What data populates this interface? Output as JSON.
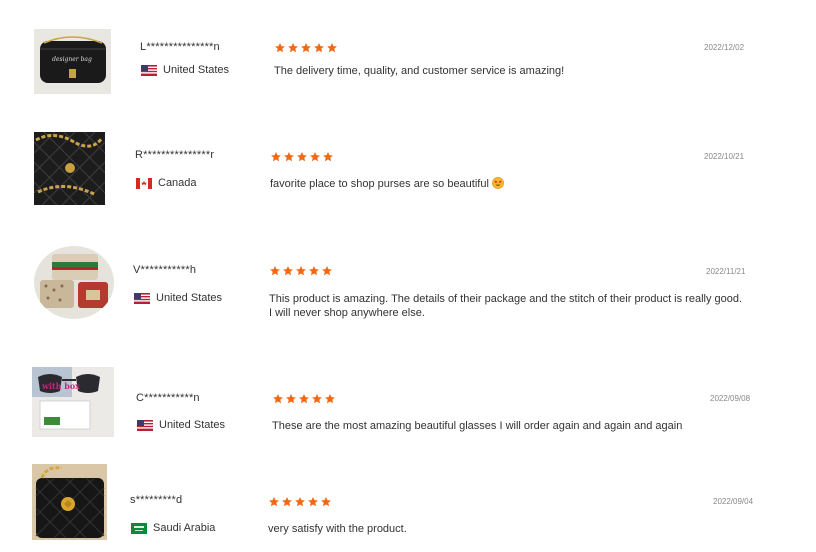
{
  "reviews": [
    {
      "user": "L***************n",
      "country": "United States",
      "flag": "us",
      "rating": 5,
      "date": "2022/12/02",
      "text": "The delivery time, quality, and customer service is amazing!",
      "thumb_text": "designer bag",
      "thumb_icon": "black-bag-thumbnail"
    },
    {
      "user": "R***************r",
      "country": "Canada",
      "flag": "ca",
      "rating": 5,
      "date": "2022/10/21",
      "text": "favorite place to shop purses are so beautiful",
      "emoji": "star-struck-emoji",
      "thumb_icon": "quilted-chain-bag-thumbnail"
    },
    {
      "user": "V***********h",
      "country": "United States",
      "flag": "us",
      "rating": 5,
      "date": "2022/11/21",
      "text": "This product is amazing. The details of their package and the stitch of their product is really good.",
      "text2": "I will never shop anywhere else.",
      "thumb_icon": "bags-round-thumbnail"
    },
    {
      "user": "C***********n",
      "country": "United States",
      "flag": "us",
      "rating": 5,
      "date": "2022/09/08",
      "text": "These are the most amazing beautiful glasses I will order again and again and again",
      "thumb_text": "with box",
      "thumb_icon": "glasses-box-thumbnail"
    },
    {
      "user": "s*********d",
      "country": "Saudi Arabia",
      "flag": "sa",
      "rating": 5,
      "date": "2022/09/04",
      "text": "very satisfy with the product.",
      "thumb_icon": "black-quilted-bag-thumbnail"
    }
  ],
  "colors": {
    "star": "#f06a16",
    "text": "#333333",
    "date": "#888888"
  }
}
